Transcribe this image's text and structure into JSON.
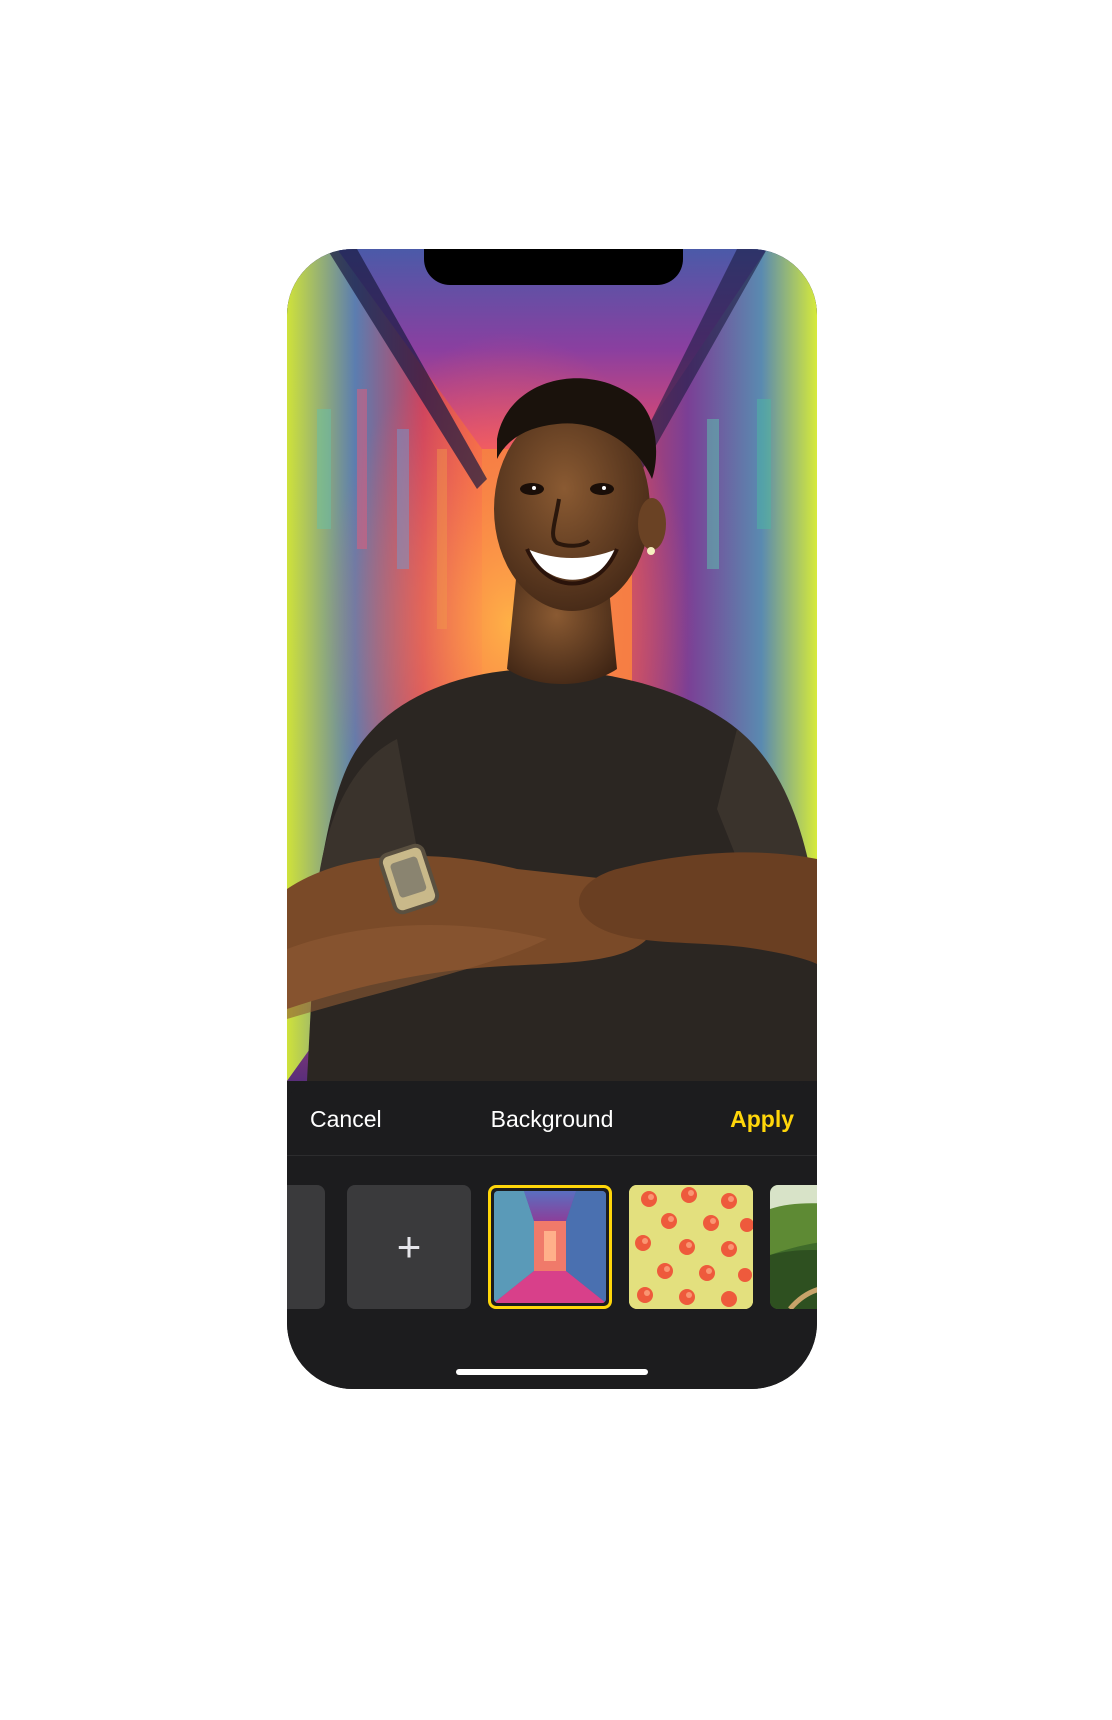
{
  "sheet": {
    "cancel_label": "Cancel",
    "title": "Background",
    "apply_label": "Apply"
  },
  "thumbnails": {
    "add_symbol": "+",
    "items": [
      {
        "name": "thumbnail-partial",
        "selected": false
      },
      {
        "name": "add-background",
        "selected": false
      },
      {
        "name": "neon-corridor",
        "selected": true
      },
      {
        "name": "peaches-pattern",
        "selected": false
      },
      {
        "name": "green-landscape",
        "selected": false
      }
    ]
  },
  "colors": {
    "accent": "#ffd60a",
    "sheet_background": "#1c1c1e",
    "tile_background": "#3a3a3c",
    "text": "#ffffff"
  }
}
